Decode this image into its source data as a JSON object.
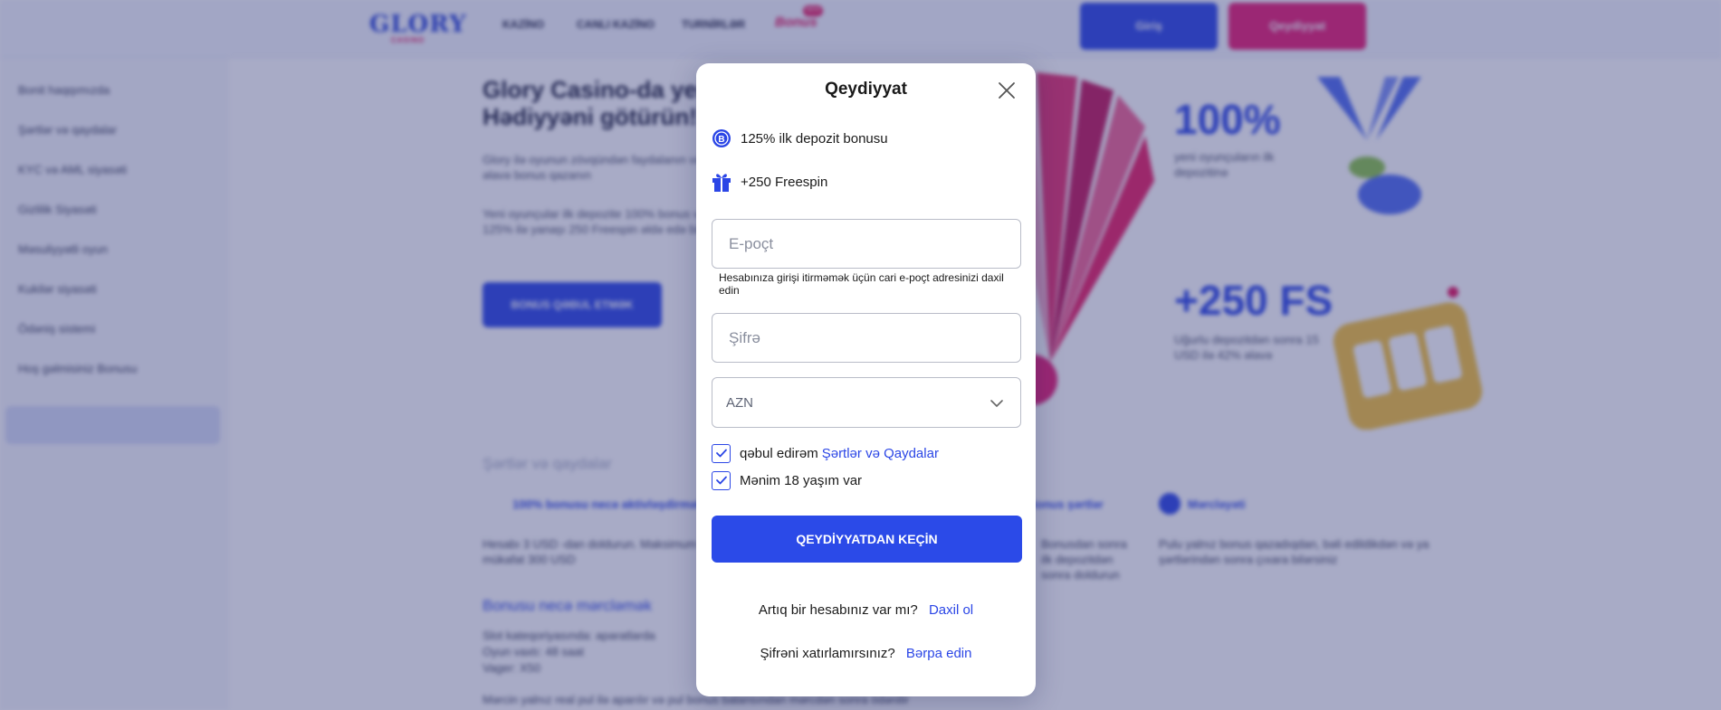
{
  "background": {
    "logo": "GLORY",
    "logo_sub": "CASINO",
    "nav": [
      "KAZİNO",
      "CANLI KAZİNO",
      "TURNİRLƏR",
      "Bonus"
    ],
    "nav_badge": "NEW",
    "login_button": "Giriş",
    "register_button": "Qeydiyyat",
    "sidebar": [
      "Bonit haqqımızda",
      "Şərtlər və qaydalar",
      "KYC və AML siyasəti",
      "Gizlilik Siyasəti",
      "Məsuliyyətli oyun",
      "Kukilər siyasəti",
      "Ödəniş sistemi",
      "Hoş gəlmisiniz Bonusu"
    ],
    "hero_title_1": "Glory Casino-da yeni",
    "hero_title_2": "Hədiyyəni götürün!",
    "hero_text_1": "Glory ilə oyunun zövqündən faydalanın və əlavə bonus qazanın",
    "hero_text_2": "Yeni oyunçular ilk depozite 100% bonus və 125% ilə yanaşı 250 Freespin əldə edə bilər",
    "hero_button": "BONUS QƏBUL ETMƏK",
    "promo1_big": "100%",
    "promo1_small": "yeni oyunçuların ilk depozitinə",
    "promo2_big": "+250 FS",
    "promo2_small": "Uğurlu depozitdən sonra 15 USD ilə 42% əlavə",
    "section1_title": "Şərtlər və qaydalar",
    "feat1": "100% bonusu necə aktivləşdirmək",
    "feat2": "Bonus şərtlər",
    "feat3": "Mərcləyəti",
    "para1": "Hesabı 3 USD -dan doldurun. Maksimum mükafat 300 USD",
    "para2": "Bonusdan sonra ilk depozitdən sonra doldurun",
    "para3": "Pulu yalnız bonus qazadıqdan, bəli edildikdən və ya şərtlərindən sonra çıxara bilərsiniz",
    "section2_title": "Bonusu necə mərcləmək",
    "list1": "Slot kateqoriyasında: aparatlarda",
    "list2": "Oyun vaxtı: 48 saat",
    "list3": "Vager: X50",
    "bottom_text": "Mərcin yalnız real pul ilə aparılır və pul bonus balansından mərcdən sonra ödənilir"
  },
  "modal": {
    "title": "Qeydiyyat",
    "bonus1": "125% ilk depozit bonusu",
    "bonus2": "+250 Freespin",
    "email_placeholder": "E-poçt",
    "email_value": "",
    "email_hint": "Hesabınıza girişi itirməmək üçün cari e-poçt adresinizi daxil edin",
    "password_placeholder": "Şifrə",
    "password_value": "",
    "currency": "AZN",
    "terms_label": "qəbul edirəm",
    "terms_link": "Şərtlər və Qaydalar",
    "terms_checked": true,
    "age_label": "Mənim 18 yaşım var",
    "age_checked": true,
    "submit": "QEYDİYYATDAN KEÇİN",
    "have_account": "Artıq bir hesabınız var mı?",
    "login_link": "Daxil ol",
    "forgot": "Şifrəni xatırlamırsınız?",
    "restore_link": "Bərpa edin"
  },
  "colors": {
    "accent": "#2b46e6",
    "brand_pink": "#e81c72",
    "overlay": "#303876"
  }
}
